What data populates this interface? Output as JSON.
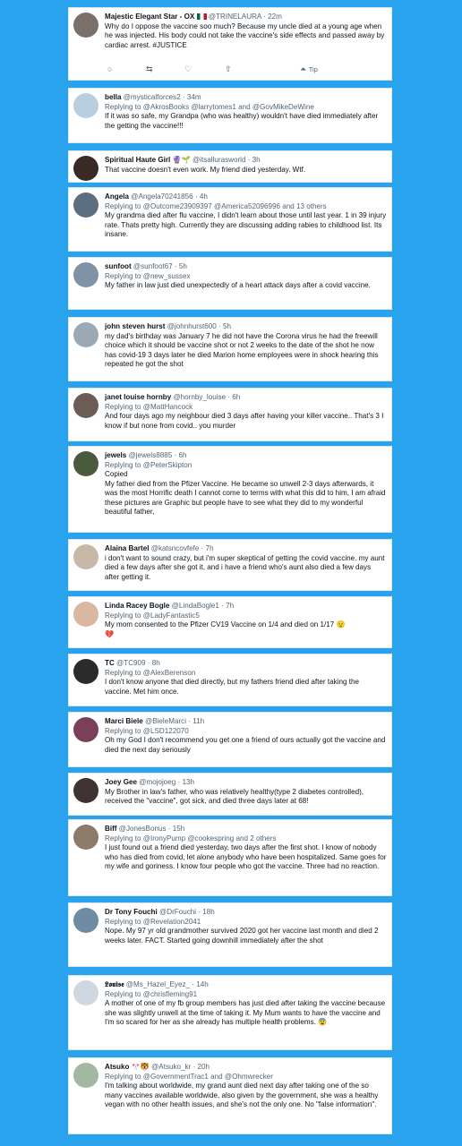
{
  "tweets": [
    {
      "name": "Majestic Elegant Star - OX",
      "handle": "@TRINELAURA",
      "time": "22m",
      "body": "Why do I oppose the vaccine soo much? Because my uncle died at a young age when he was injected. His body could not take the vaccine's side effects and passed away by cardiac arrest. #JUSTICE",
      "actions": {
        "reply": "○",
        "retweet": "⇆",
        "like": "♡",
        "share": "⇧",
        "tip_icon": "⏶",
        "tip": "Tip"
      }
    },
    {
      "name": "bella",
      "handle": "@mysticalforces2",
      "time": "34m",
      "replying": "Replying to @AkrosBooks @larrytomes1 and @GovMikeDeWine",
      "body": "If it was so safe, my Grandpa (who was healthy) wouldn't have died immediately after the getting the vaccine!!!"
    },
    {
      "name": "Spiritual Haute Girl",
      "name_emoji": "🔮🌱",
      "handle": "@itsallurasworld",
      "time": "3h",
      "body": "That vaccine doesn't even work. My friend died yesterday. Wtf."
    },
    {
      "name": "Angela",
      "handle": "@Angela70241856",
      "time": "4h",
      "replying": "Replying to @Outcome23909397 @America52096996 and 13 others",
      "body": "My grandma died after flu vaccine, I didn't learn about those until last year. 1 in 39 injury rate. Thats pretty high. Currently they are discussing adding rabies to childhood list. Its insane."
    },
    {
      "name": "sunfoot",
      "handle": "@sunfoot67",
      "time": "5h",
      "replying": "Replying to @new_sussex",
      "body": "My father in law just died unexpectedly of a heart attack days after a covid vaccine."
    },
    {
      "name": "john steven hurst",
      "handle": "@johnhurst600",
      "time": "5h",
      "body": "my dad's birthday was January 7 he did not have the Corona virus he had the freewill choice which it should be vaccine shot or not 2 weeks to the date of the shot he now has covid-19 3 days later he died Marion home employees were in shock hearing this repeated he got the shot"
    },
    {
      "name": "janet louise hornby",
      "handle": "@hornby_louise",
      "time": "6h",
      "replying": "Replying to @MattHancock",
      "body": "And four days ago my neighbour died  3 days after having your killer vaccine.. That's 3 I know if but none from covid.. you murder"
    },
    {
      "name": "jewels",
      "handle": "@jewels8885",
      "time": "6h",
      "replying": "Replying to @PeterSkipton",
      "body": "Copied\nMy father died from the Pfizer Vaccine. He became so unwell 2-3 days afterwards, it was the most Horrific death I cannot come to terms with what this did to him, I am afraid these pictures are Graphic but people have to see what they did to my wonderful beautiful father,"
    },
    {
      "name": "Alaina Bartel",
      "handle": "@katsncovfefe",
      "time": "7h",
      "body": "i don't want to sound crazy, but i'm super skeptical of getting the covid vaccine. my aunt died a few days after she got it, and i have a friend who's aunt also died a few days after getting it."
    },
    {
      "name": "Linda Racey Bogle",
      "handle": "@LindaBogle1",
      "time": "7h",
      "replying": "Replying to @LadyFantastic5",
      "body": "My mom consented to the Pfizer CV19 Vaccine on 1/4 and died on 1/17 😟\n💔"
    },
    {
      "name": "TC",
      "handle": "@TC909",
      "time": "8h",
      "replying": "Replying to @AlexBerenson",
      "body": "I don't know anyone that died directly, but my fathers friend died after taking the vaccine. Met him once."
    },
    {
      "name": "Marci Biele",
      "handle": "@BieleMarci",
      "time": "11h",
      "replying": "Replying to @LSD122070",
      "body": "Oh my God I don't recommend you get one a friend of ours actually got the vaccine and died the next day seriously"
    },
    {
      "name": "Joey Gee",
      "handle": "@mojojoeg",
      "time": "13h",
      "body": "My Brother in law's father, who was relatively healthy(type 2 diabetes controlled), received the \"vaccine\", got sick, and died three days later at 68!"
    },
    {
      "name": "Biff",
      "handle": "@JonesBonus",
      "time": "15h",
      "replying": "Replying to @IronyPump @cookespring and 2 others",
      "body": "I just found out a friend died yesterday, two days after the first shot.  I know of nobody who has died from covid, let alone anybody who have been hospitalized.  Same goes for my wife and goriness.  I know four people who got the vaccine.  Three had no reaction."
    },
    {
      "name": "Dr Tony Fouchi",
      "handle": "@DrFouchi",
      "time": "18h",
      "replying": "Replying to @Revelation2041",
      "body": "Nope. My 97 yr old grandmother survived 2020 got her vaccine last month and died 2 weeks later. FACT.  Started going downhill immediately after the shot"
    },
    {
      "name": "𝕷𝖔𝖚𝖎𝖘𝖊",
      "handle": "@Ms_Hazel_Eyez_",
      "time": "14h",
      "replying": "Replying to @chrisfleming91",
      "body": "A mother of one of my fb group members has just died after taking the vaccine because she was slightly unwell at the time of taking it. My Mum wants to have the vaccine and I'm so scared for her as she already has multiple health problems. 😨"
    },
    {
      "name": "Atsuko",
      "name_emoji": "🎌🐯",
      "handle": "@Atsuko_kr",
      "time": "20h",
      "replying": "Replying to @GovernmentTrac1 and @Ohmwrecker",
      "body": "I'm talking about worldwide, my grand aunt died next day after taking one of the so many vaccines available worldwide, also given by the government, she was a healthy vegan with no other health issues, and she's not the only one. No \"false information\"."
    }
  ]
}
